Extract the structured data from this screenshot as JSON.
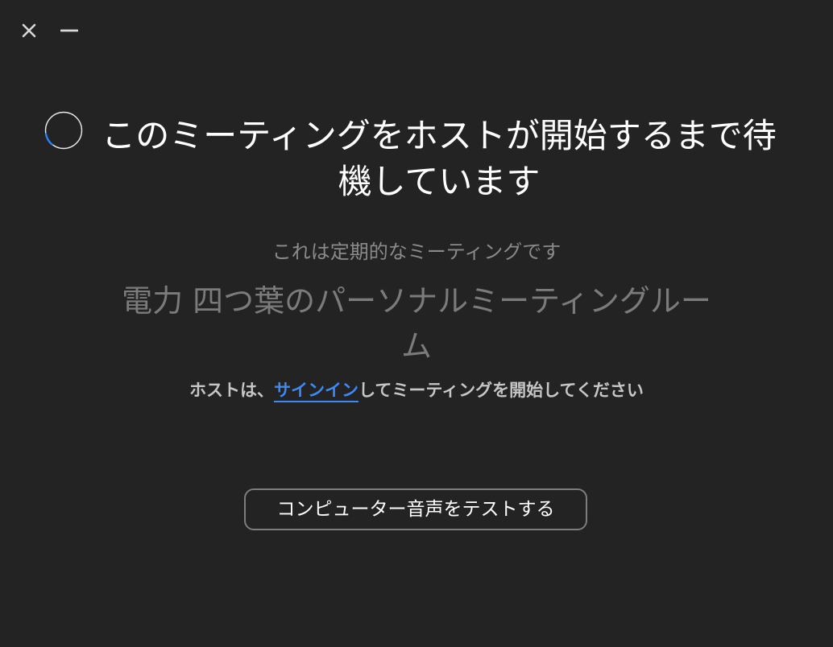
{
  "window": {
    "close_icon": "close-icon",
    "minimize_icon": "minimize-icon"
  },
  "status": {
    "spinner_icon": "loading-spinner-icon",
    "headline": "このミーティングをホストが開始するまで待機しています"
  },
  "meeting": {
    "recurring_note": "これは定期的なミーティングです",
    "name": "電力 四つ葉のパーソナルミーティングルーム"
  },
  "host_hint": {
    "prefix": "ホストは、",
    "link": "サインイン",
    "suffix": "してミーティングを開始してください"
  },
  "actions": {
    "test_audio_label": "コンピューター音声をテストする"
  },
  "colors": {
    "background": "#232323",
    "link": "#3d8af7",
    "spinner_accent": "#2f80ed"
  }
}
